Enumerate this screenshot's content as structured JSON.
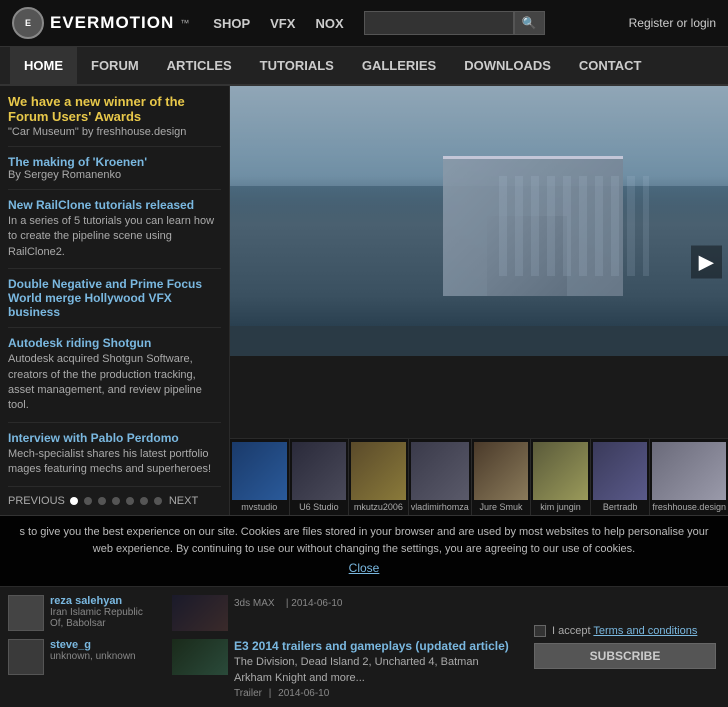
{
  "header": {
    "logo_text": "EVERMOTION",
    "logo_tm": "™",
    "nav": [
      {
        "label": "SHOP",
        "href": "#"
      },
      {
        "label": "VFX",
        "href": "#"
      },
      {
        "label": "NOX",
        "href": "#"
      }
    ],
    "search_placeholder": "",
    "register_login": "Register or login"
  },
  "main_nav": [
    {
      "label": "HOME",
      "active": true
    },
    {
      "label": "FORUM"
    },
    {
      "label": "ARTICLES"
    },
    {
      "label": "TUTORIALS"
    },
    {
      "label": "GALLERIES"
    },
    {
      "label": "DOWNLOADS"
    },
    {
      "label": "CONTACT"
    }
  ],
  "news": [
    {
      "type": "highlight",
      "title": "We have a new winner of the Forum Users' Awards",
      "subtitle": "\"Car Museum\" by freshhouse.design"
    },
    {
      "type": "normal",
      "title": "The making of 'Kroenen'",
      "author": "By Sergey Romanenko"
    },
    {
      "type": "normal",
      "title": "New RailClone tutorials released",
      "desc": "In a series of 5 tutorials you can learn how to create the pipeline scene using RailClone2."
    },
    {
      "type": "normal",
      "title": "Double Negative and Prime Focus World merge Hollywood VFX business"
    },
    {
      "type": "normal",
      "title": "Autodesk riding Shotgun",
      "desc": "Autodesk acquired Shotgun Software, creators of the the production tracking, asset management, and review pipeline tool."
    },
    {
      "type": "normal",
      "title": "Interview with Pablo Perdomo",
      "desc": "Mech-specialist shares his latest portfolio mages featuring mechs and superheroes!"
    }
  ],
  "slider_controls": {
    "prev": "PREVIOUS",
    "next": "NEXT",
    "dots": 7,
    "active_dot": 0
  },
  "thumbnails": [
    {
      "label": "mvstudio",
      "color_class": "thumb-blue"
    },
    {
      "label": "U6 Studio",
      "color_class": "thumb-dark"
    },
    {
      "label": "mkutzu2006",
      "color_class": "thumb-gold"
    },
    {
      "label": "vladimirhomza",
      "color_class": "thumb-gray"
    },
    {
      "label": "Jure Smuk",
      "color_class": "thumb-beige"
    },
    {
      "label": "kim jungin",
      "color_class": "thumb-sand"
    },
    {
      "label": "Bertradb",
      "color_class": "thumb-arch"
    },
    {
      "label": "freshhouse.design",
      "color_class": "thumb-white"
    }
  ],
  "cookie_bar": {
    "text": "s to give you the best experience on our site. Cookies are files stored in your browser and are used by most websites to help personalise your web experience. By continuing to use our without changing the settings, you are agreeing to our use of cookies.",
    "close": "Close"
  },
  "users": [
    {
      "name": "reza salehyan",
      "location": "Iran Islamic Republic Of, Babolsar"
    },
    {
      "name": "steve_g",
      "location": "unknown, unknown"
    }
  ],
  "articles": [
    {
      "tag": "3ds MAX",
      "date": "2014-06-10",
      "title": "",
      "desc": ""
    },
    {
      "tag": "Trailer",
      "date": "2014-06-10",
      "title": "E3 2014 trailers and gameplays (updated article)",
      "desc": "The Division, Dead Island 2, Uncharted 4, Batman Arkham Knight and more..."
    }
  ],
  "subscribe": {
    "label": "I accept Terms and conditions",
    "button": "SUBSCRIBE"
  }
}
